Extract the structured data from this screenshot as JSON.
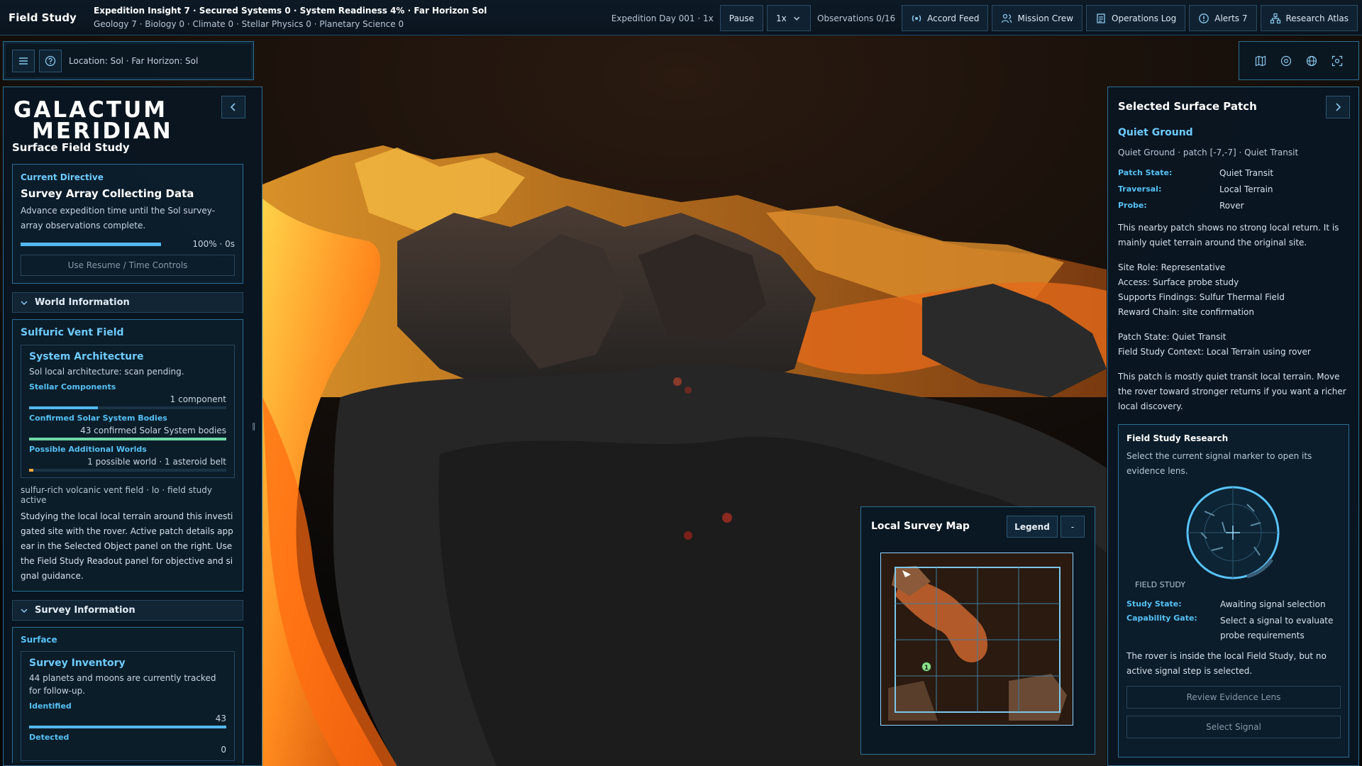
{
  "topbar": {
    "title": "Field Study",
    "stats_line1": "Expedition Insight 7 · Secured Systems 0 · System Readiness 4% · Far Horizon Sol",
    "stats_line2": "Geology 7 · Biology 0 · Climate 0 · Stellar Physics 0 · Planetary Science 0",
    "expedition_day": "Expedition Day 001 · 1x",
    "pause_label": "Pause",
    "speed_value": "1x",
    "observations": "Observations 0/16",
    "buttons": [
      {
        "label": "Accord Feed",
        "icon": "broadcast-icon"
      },
      {
        "label": "Mission Crew",
        "icon": "crew-icon"
      },
      {
        "label": "Operations Log",
        "icon": "log-icon"
      },
      {
        "label": "Alerts 7",
        "icon": "alert-icon"
      },
      {
        "label": "Research Atlas",
        "icon": "atlas-icon"
      }
    ]
  },
  "location": {
    "text": "Location: Sol · Far Horizon: Sol"
  },
  "left": {
    "logo_line1": "GALACTUM",
    "logo_line2": "MERIDIAN",
    "subtitle": "Surface Field Study",
    "directive": {
      "kicker": "Current Directive",
      "title": "Survey Array Collecting Data",
      "desc": "Advance expedition time until the Sol survey-array observations complete.",
      "progress": 1.0,
      "progress_text": "100% · 0s",
      "button": "Use Resume / Time Controls"
    },
    "world": {
      "header": "World Information",
      "field_title": "Sulfuric Vent Field",
      "arch_title": "System Architecture",
      "arch_desc": "Sol local architecture: scan pending.",
      "stellar_label": "Stellar Components",
      "stellar_value": "1 component",
      "stellar_fill": 0.35,
      "confirmed_label": "Confirmed Solar System Bodies",
      "confirmed_value": "43 confirmed Solar System bodies",
      "confirmed_fill": 1.0,
      "possible_label": "Possible Additional Worlds",
      "possible_value": "1 possible world · 1 asteroid belt",
      "possible_fill": 0.02,
      "note": "sulfur-rich volcanic vent field · lo · field study active",
      "para": "Studying the local local terrain around this investigated site with the rover. Active patch details appear in the Selected Object panel on the right. Use the Field Study Readout panel for objective and signal guidance."
    },
    "survey": {
      "header": "Survey Information",
      "surface_label": "Surface",
      "inv_title": "Survey Inventory",
      "inv_desc": "44 planets and moons are currently tracked for follow-up.",
      "identified_label": "Identified",
      "identified_value": "43",
      "identified_fill": 1.0,
      "detected_label": "Detected",
      "detected_value": "0"
    }
  },
  "right": {
    "title": "Selected Surface Patch",
    "heading": "Quiet Ground",
    "subline": "Quiet Ground · patch [-7,-7] · Quiet Transit",
    "kv": [
      {
        "k": "Patch State:",
        "v": "Quiet Transit"
      },
      {
        "k": "Traversal:",
        "v": "Local Terrain"
      },
      {
        "k": "Probe:",
        "v": "Rover"
      }
    ],
    "p1": "This nearby patch shows no strong local return. It is mainly quiet terrain around the original site.",
    "p2_lines": [
      "Site Role: Representative",
      "Access: Surface probe study",
      "Supports Findings: Sulfur Thermal Field",
      "Reward Chain: site confirmation"
    ],
    "p3_lines": [
      "Patch State: Quiet Transit",
      "Field Study Context: Local Terrain using rover"
    ],
    "p4": "This patch is mostly quiet transit local terrain. Move the rover toward stronger returns if you want a richer local discovery.",
    "research": {
      "title": "Field Study Research",
      "desc": "Select the current signal marker to open its evidence lens.",
      "radar_label": "FIELD STUDY",
      "kv": [
        {
          "k": "Study State:",
          "v": "Awaiting signal selection"
        },
        {
          "k": "Capability Gate:",
          "v": "Select a signal to evaluate probe requirements"
        }
      ],
      "note": "The rover is inside the local Field Study, but no active signal step is selected.",
      "btn1": "Review Evidence Lens",
      "btn2": "Select Signal"
    }
  },
  "survey_map": {
    "title": "Local Survey Map",
    "legend": "Legend",
    "minimize": "-",
    "marker_label": "1"
  },
  "colors": {
    "accent": "#6ecbff",
    "panel_border": "#2d6f92",
    "lava": "#ff8a1e"
  }
}
